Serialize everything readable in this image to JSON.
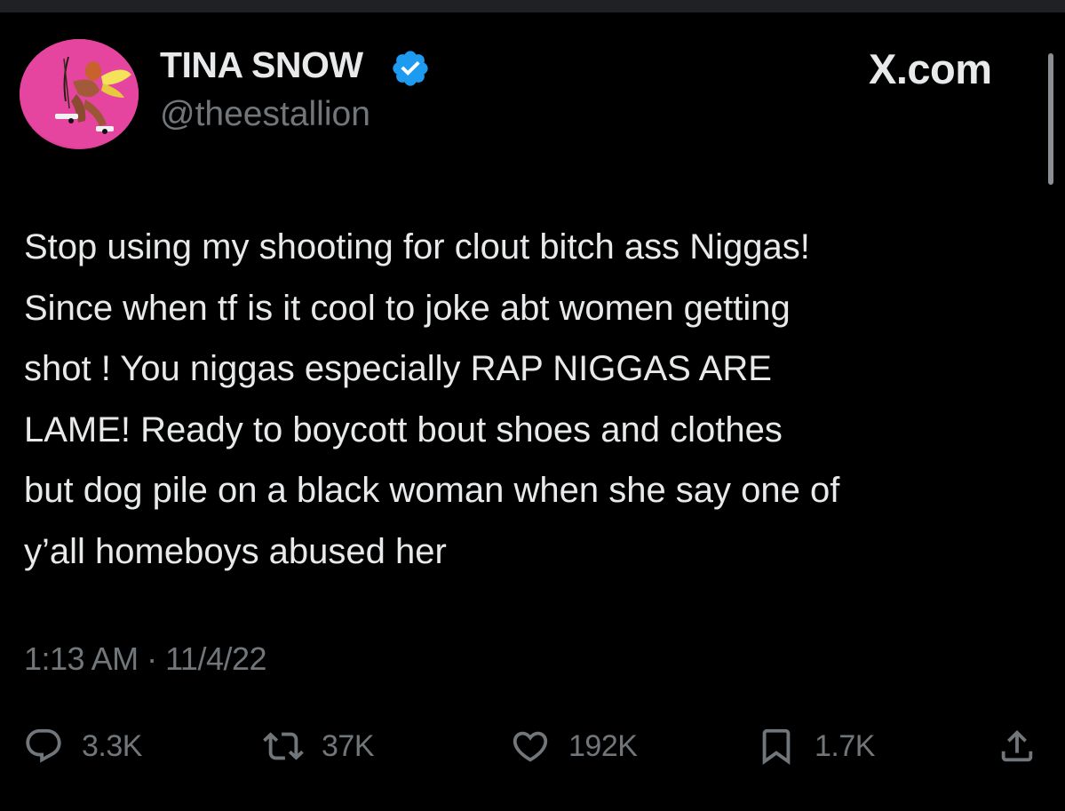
{
  "author": {
    "display_name": "TINA SNOW",
    "handle": "@theestallion",
    "verified_icon": "verified-badge-icon",
    "avatar_icon": "profile-avatar"
  },
  "brand": {
    "label": "X.com"
  },
  "tweet": {
    "lines": [
      "Stop using my shooting for clout bitch ass Niggas!",
      "Since when tf is it cool to joke abt women getting",
      "shot ! You niggas especially RAP NIGGAS ARE",
      "LAME! Ready to boycott bout shoes and clothes",
      "but dog pile on a black woman when she say one of",
      "y’all homeboys abused her"
    ],
    "timestamp": "1:13 AM · 11/4/22"
  },
  "actions": {
    "replies": {
      "icon": "reply-icon",
      "count": "3.3K"
    },
    "reposts": {
      "icon": "repost-icon",
      "count": "37K"
    },
    "likes": {
      "icon": "heart-icon",
      "count": "192K"
    },
    "bookmarks": {
      "icon": "bookmark-icon",
      "count": "1.7K"
    },
    "share": {
      "icon": "share-icon"
    }
  },
  "colors": {
    "background": "#000000",
    "primary_text": "#e7e9ea",
    "secondary_text": "#71767b",
    "verified_blue": "#1d9bf0"
  }
}
